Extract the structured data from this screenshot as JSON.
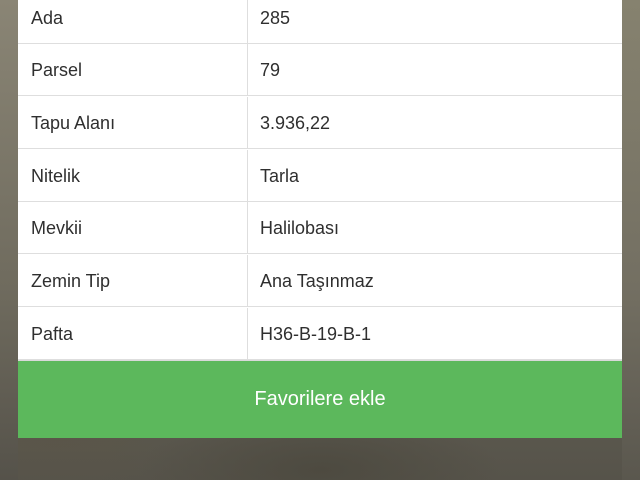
{
  "details": {
    "rows": [
      {
        "label": "Ada",
        "value": "285"
      },
      {
        "label": "Parsel",
        "value": "79"
      },
      {
        "label": "Tapu Alanı",
        "value": "3.936,22"
      },
      {
        "label": "Nitelik",
        "value": "Tarla"
      },
      {
        "label": "Mevkii",
        "value": "Halilobası"
      },
      {
        "label": "Zemin Tip",
        "value": "Ana Taşınmaz"
      },
      {
        "label": "Pafta",
        "value": "H36-B-19-B-1"
      }
    ]
  },
  "favorites": {
    "button_label": "Favorilere ekle",
    "color": "#5cb85c"
  }
}
